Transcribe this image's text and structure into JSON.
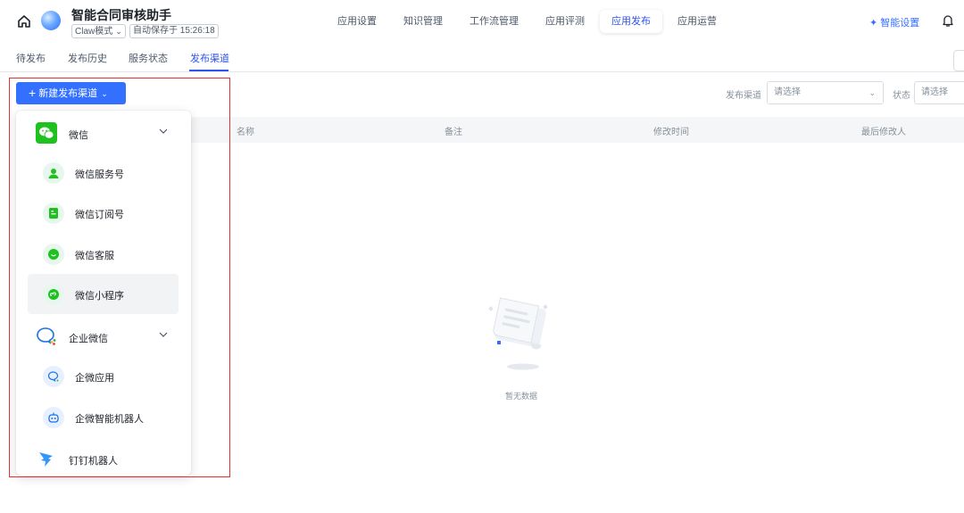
{
  "header": {
    "app_title": "智能合同审核助手",
    "mode_label": "Claw模式",
    "autosave_text": "自动保存于 15:26:18",
    "nav_tabs": [
      {
        "label": "应用设置",
        "active": false
      },
      {
        "label": "知识管理",
        "active": false
      },
      {
        "label": "工作流管理",
        "active": false
      },
      {
        "label": "应用评测",
        "active": false
      },
      {
        "label": "应用发布",
        "active": true
      },
      {
        "label": "应用运营",
        "active": false
      }
    ],
    "smart_settings_label": "智能设置",
    "accent_color": "#3370ff"
  },
  "sub_tabs": [
    {
      "label": "待发布",
      "active": false
    },
    {
      "label": "发布历史",
      "active": false
    },
    {
      "label": "服务状态",
      "active": false
    },
    {
      "label": "发布渠道",
      "active": true
    }
  ],
  "toolbar": {
    "new_channel_label": "新建发布渠道",
    "filters": [
      {
        "label": "发布渠道",
        "placeholder": "请选择"
      },
      {
        "label": "状态",
        "placeholder": "请选择"
      }
    ]
  },
  "table": {
    "columns": [
      "名称",
      "备注",
      "修改时间",
      "最后修改人"
    ],
    "empty_text": "暂无数据"
  },
  "dropdown": {
    "groups": [
      {
        "label": "微信",
        "icon": "wechat-icon",
        "expanded": true,
        "items": [
          {
            "label": "微信服务号",
            "icon": "wechat-service-account-icon"
          },
          {
            "label": "微信订阅号",
            "icon": "wechat-subscription-icon"
          },
          {
            "label": "微信客服",
            "icon": "wechat-customer-service-icon"
          },
          {
            "label": "微信小程序",
            "icon": "wechat-mini-program-icon",
            "hovered": true
          }
        ]
      },
      {
        "label": "企业微信",
        "icon": "wecom-icon",
        "expanded": true,
        "items": [
          {
            "label": "企微应用",
            "icon": "wecom-app-icon"
          },
          {
            "label": "企微智能机器人",
            "icon": "wecom-bot-icon"
          }
        ]
      },
      {
        "label": "钉钉机器人",
        "icon": "dingtalk-icon",
        "expanded": false,
        "items": []
      }
    ]
  }
}
